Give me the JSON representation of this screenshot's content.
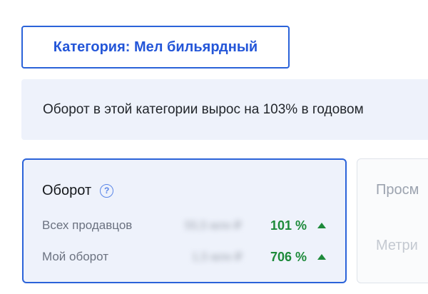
{
  "category_chip": {
    "label": "Категория: Мел бильярдный"
  },
  "banner": {
    "text": "Оборот в этой категории вырос на 103% в годовом"
  },
  "metric_card": {
    "title": "Оборот",
    "help_icon": "question-circle-icon",
    "rows": [
      {
        "label": "Всех продавцов",
        "value": "55,5 млн ₽",
        "percent": "101 %",
        "trend": "up"
      },
      {
        "label": "Мой оборот",
        "value": "1,5 млн ₽",
        "percent": "706 %",
        "trend": "up"
      }
    ],
    "accent_color": "#2b63d9",
    "positive_color": "#1d8a3a"
  },
  "side_card": {
    "title": "Просм",
    "subtitle": "Метри"
  }
}
